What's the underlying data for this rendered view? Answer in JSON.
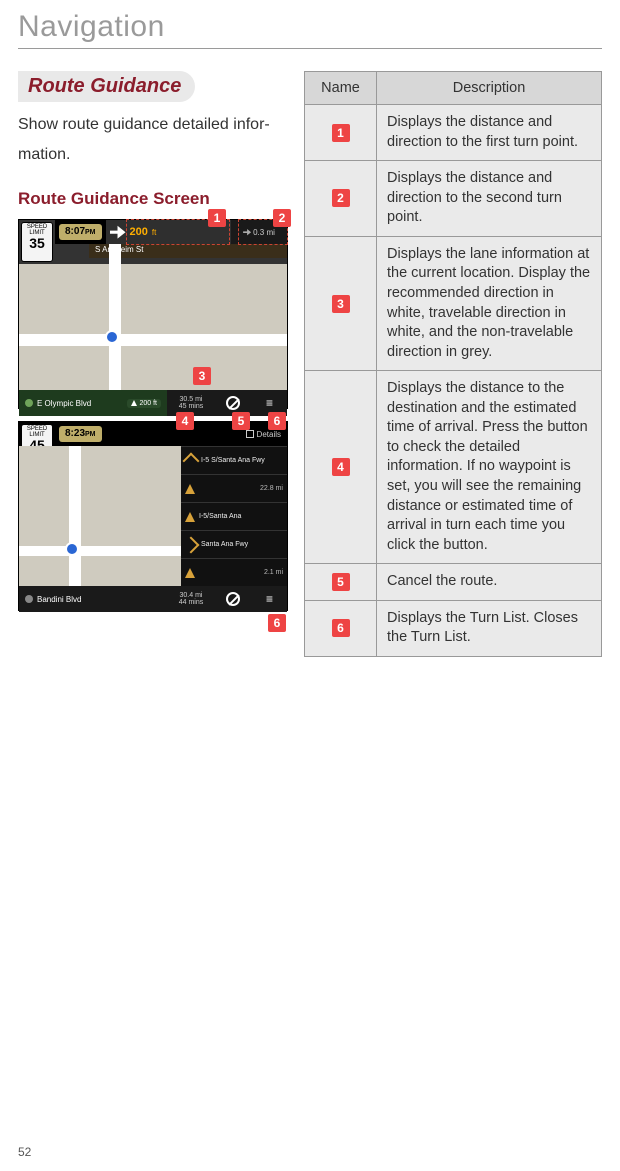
{
  "page": {
    "title": "Navigation",
    "number": "52"
  },
  "section": {
    "box_title": "Route Guidance",
    "intro": "Show route guidance detailed infor­mation.",
    "sub_title": "Route Guidance Screen"
  },
  "shot1": {
    "speed_label": "SPEED LIMIT",
    "speed_value": "35",
    "clock": "8:07",
    "ampm": "PM",
    "turn1_dist": "200",
    "turn1_unit": "ft",
    "turn2_dist": "0.3",
    "turn2_unit": "mi",
    "street": "S Anaheim St",
    "bot_street": "E Olympic Blvd",
    "bot_progress": "200 ft",
    "eta_dist": "30.5 mi",
    "eta_time": "45 mins",
    "cancel_label": "Cancel Route"
  },
  "shot2": {
    "speed_label": "SPEED LIMIT",
    "speed_value": "45",
    "clock": "8:23",
    "ampm": "PM",
    "details": "Details",
    "rows": [
      {
        "name": "I-5 S/Santa Ana Fwy",
        "mi": ""
      },
      {
        "name": "",
        "mi": "22.8 mi"
      },
      {
        "name": "I-5/Santa Ana",
        "mi": ""
      },
      {
        "name": "Santa Ana Fwy",
        "mi": ""
      },
      {
        "name": "",
        "mi": "2.1 mi"
      }
    ],
    "bot_street": "Bandini Blvd",
    "eta_dist": "30.4 mi",
    "eta_time": "44 mins"
  },
  "markers": {
    "m1": "1",
    "m2": "2",
    "m3": "3",
    "m4": "4",
    "m5": "5",
    "m6": "6"
  },
  "table": {
    "head_name": "Name",
    "head_desc": "Description",
    "rows": [
      {
        "num": "1",
        "desc": "Displays the distance and direction to the first turn point."
      },
      {
        "num": "2",
        "desc": "Displays the distance and direction to the second turn point."
      },
      {
        "num": "3",
        "desc": "Displays the lane informa­tion at the current location. Display the recommended direction in white, travel­able direction in white, and the non-travelable direction in grey."
      },
      {
        "num": "4",
        "desc": "Displays the distance to the destination and the estimated time of arrival. Press the button to check the detailed information. If no waypoint is set, you will see the remaining distance or estimated time of arrival in turn each time you click the button."
      },
      {
        "num": "5",
        "desc": "Cancel the route."
      },
      {
        "num": "6",
        "desc": "Displays the Turn List. Closes the Turn List."
      }
    ]
  }
}
